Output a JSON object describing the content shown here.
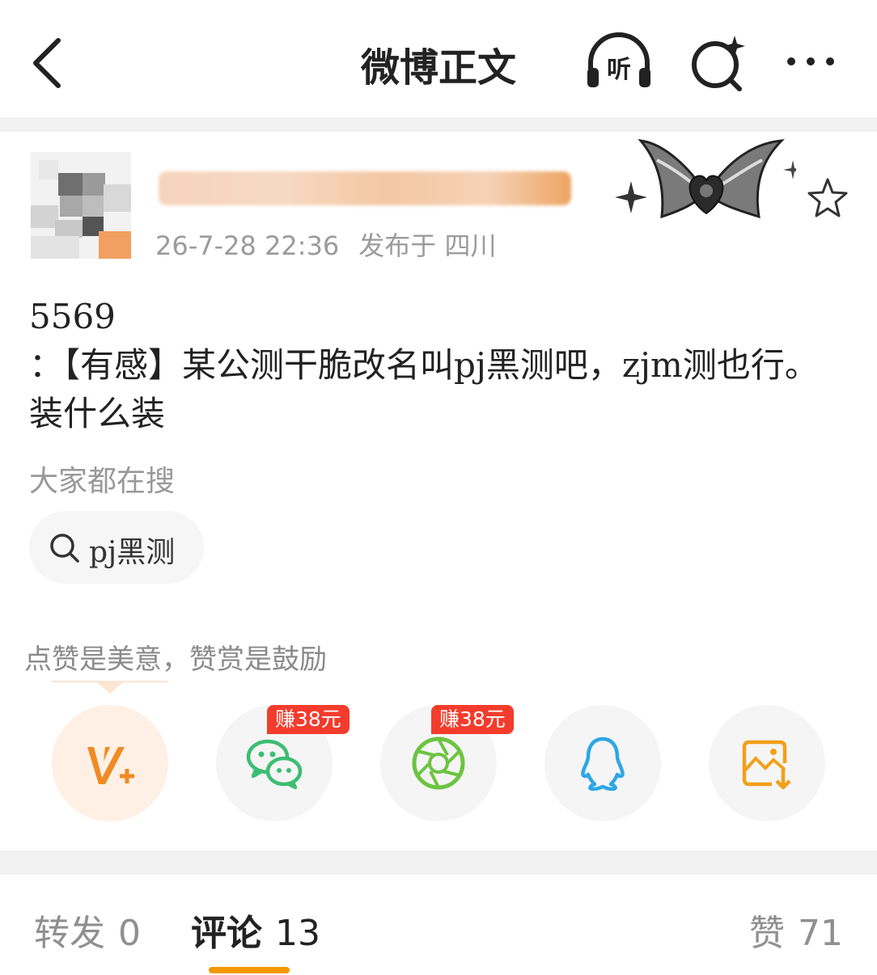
{
  "header": {
    "title": "微博正文",
    "listen_label": "听"
  },
  "post": {
    "timestamp": "26-7-28 22:36",
    "location": "发布于 四川",
    "text": "5569\n：【有感】某公测干脆改名叫pj黑测吧，zjm测也行。装什么装"
  },
  "search": {
    "hint": "大家都在搜",
    "tag": "pj黑测"
  },
  "reward": {
    "hint": "点赞是美意，赞赏是鼓励"
  },
  "share": {
    "wechat_badge": "赚38元",
    "moments_badge": "赚38元"
  },
  "tabs": {
    "repost_label": "转发",
    "repost_count": "0",
    "comment_label": "评论",
    "comment_count": "13",
    "like_label": "赞",
    "like_count": "71"
  },
  "colors": {
    "accent": "#f39800",
    "reward_orange": "#f08a24",
    "wechat_green": "#3dbd73",
    "moments_green": "#6cc440",
    "qq_blue": "#2fa6e6",
    "badge_red": "#f43c2d"
  }
}
